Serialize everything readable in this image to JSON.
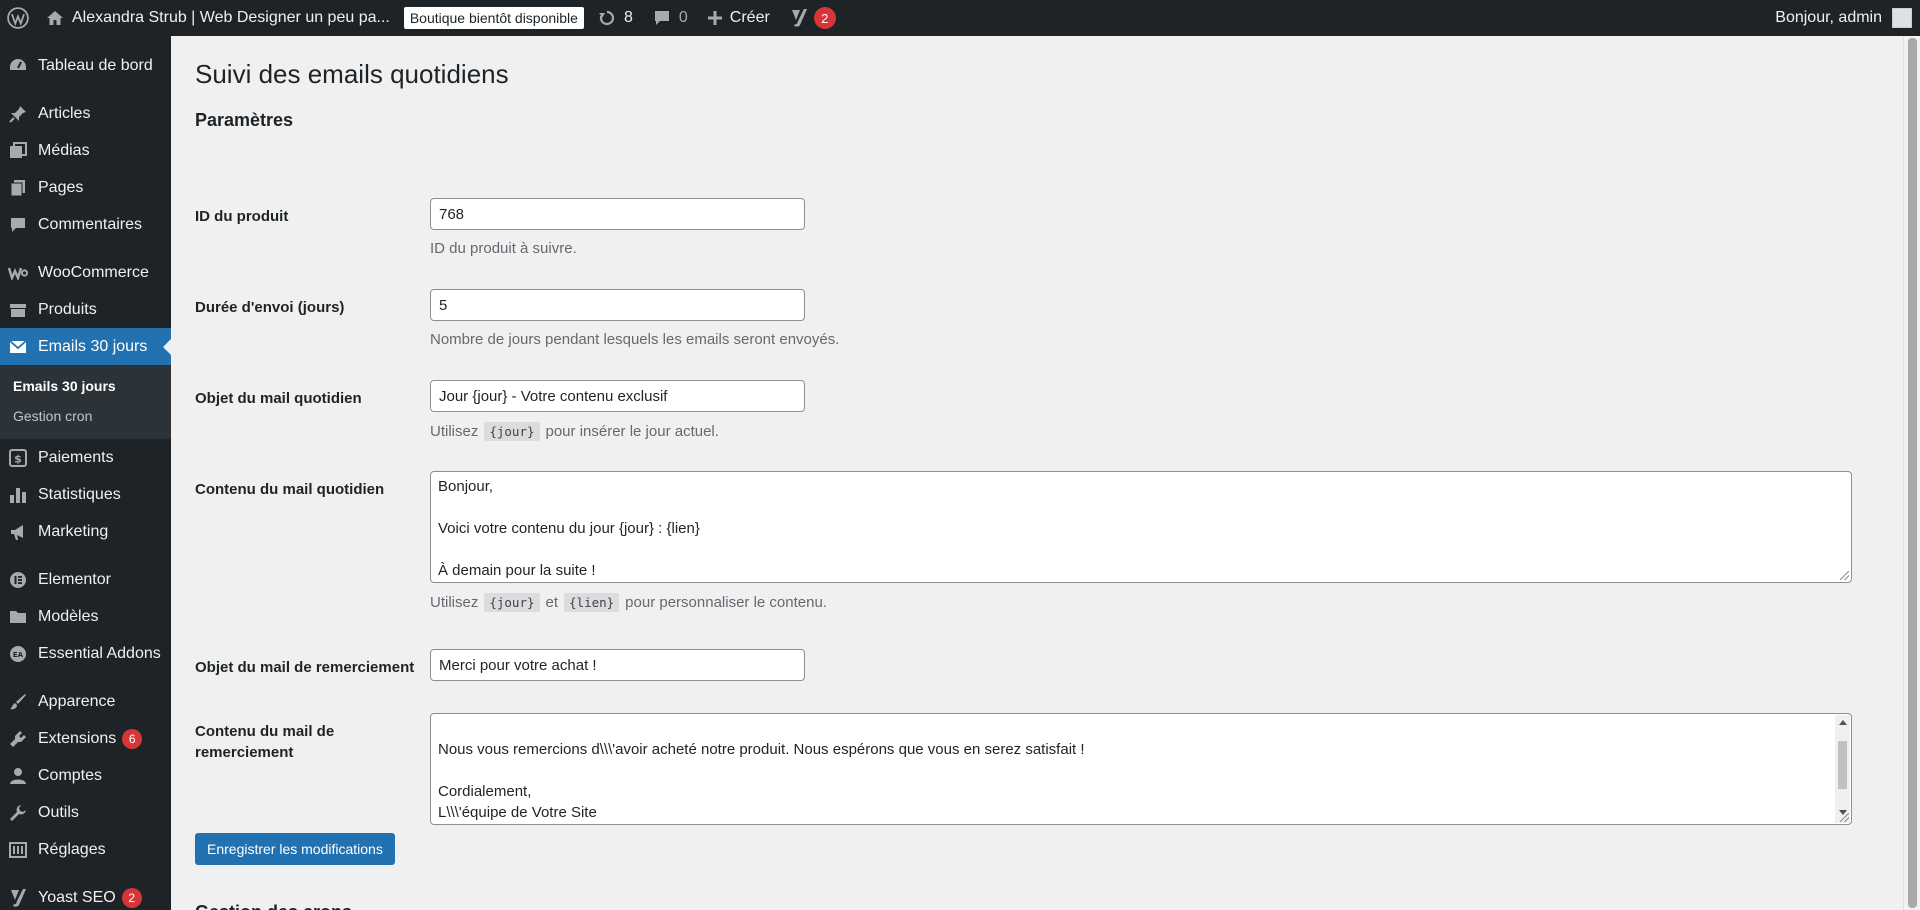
{
  "adminbar": {
    "site_name": "Alexandra Strub | Web Designer un peu pa...",
    "store_badge": "Boutique bientôt disponible",
    "updates_count": "8",
    "comments_count": "0",
    "create_label": "Créer",
    "yoast_count": "2",
    "greeting": "Bonjour, admin"
  },
  "sidebar": {
    "items": [
      {
        "label": "Tableau de bord",
        "icon": "dashboard-icon"
      },
      {
        "label": "Articles",
        "icon": "pin-icon"
      },
      {
        "label": "Médias",
        "icon": "media-icon"
      },
      {
        "label": "Pages",
        "icon": "pages-icon"
      },
      {
        "label": "Commentaires",
        "icon": "comment-icon"
      },
      {
        "label": "WooCommerce",
        "icon": "woocommerce-icon"
      },
      {
        "label": "Produits",
        "icon": "archive-icon"
      },
      {
        "label": "Emails 30 jours",
        "icon": "email-icon"
      },
      {
        "label": "Paiements",
        "icon": "payments-icon"
      },
      {
        "label": "Statistiques",
        "icon": "chart-icon"
      },
      {
        "label": "Marketing",
        "icon": "megaphone-icon"
      },
      {
        "label": "Elementor",
        "icon": "elementor-icon"
      },
      {
        "label": "Modèles",
        "icon": "folder-icon"
      },
      {
        "label": "Essential Addons",
        "icon": "essential-addons-icon"
      },
      {
        "label": "Apparence",
        "icon": "brush-icon"
      },
      {
        "label": "Extensions",
        "icon": "plugin-icon",
        "badge": "6"
      },
      {
        "label": "Comptes",
        "icon": "user-icon"
      },
      {
        "label": "Outils",
        "icon": "wrench-icon"
      },
      {
        "label": "Réglages",
        "icon": "settings-icon"
      },
      {
        "label": "Yoast SEO",
        "icon": "yoast-icon",
        "badge": "2"
      }
    ],
    "submenu": [
      "Emails 30 jours",
      "Gestion cron"
    ]
  },
  "main": {
    "page_title": "Suivi des emails quotidiens",
    "section_title": "Paramètres",
    "product_id_label": "ID du produit",
    "product_id_value": "768",
    "product_id_desc": "ID du produit à suivre.",
    "duration_label": "Durée d'envoi (jours)",
    "duration_value": "5",
    "duration_desc": "Nombre de jours pendant lesquels les emails seront envoyés.",
    "daily_subject_label": "Objet du mail quotidien",
    "daily_subject_value": "Jour {jour} - Votre contenu exclusif",
    "daily_subject_desc_before": "Utilisez",
    "daily_subject_desc_code": "{jour}",
    "daily_subject_desc_after": "pour insérer le jour actuel.",
    "daily_content_label": "Contenu du mail quotidien",
    "daily_content_lines": [
      "Bonjour,",
      "",
      "Voici votre contenu du jour {jour} : {lien}",
      "",
      "À demain pour la suite !"
    ],
    "daily_content_desc_before": "Utilisez",
    "daily_content_desc_code1": "{jour}",
    "daily_content_desc_mid": "et",
    "daily_content_desc_code2": "{lien}",
    "daily_content_desc_after": "pour personnaliser le contenu.",
    "thanks_subject_label": "Objet du mail de remerciement",
    "thanks_subject_value": "Merci pour votre achat !",
    "thanks_content_label": "Contenu du mail de remerciement",
    "thanks_content_lines": [
      "",
      "Nous vous remercions d\\\\\\'avoir acheté notre produit. Nous espérons que vous en serez satisfait !",
      "",
      "Cordialement,",
      "L\\\\\\'équipe de Votre Site"
    ],
    "save_button": "Enregistrer les modifications",
    "next_section_title": "Gestion des crons"
  }
}
